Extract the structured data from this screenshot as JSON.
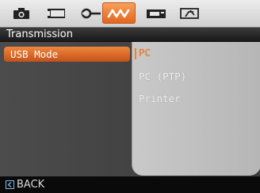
{
  "tabs": [
    {
      "icon": "camera-icon",
      "active": false
    },
    {
      "icon": "video-icon",
      "active": false
    },
    {
      "icon": "wrench-icon",
      "active": false
    },
    {
      "icon": "connection-icon",
      "active": true
    },
    {
      "icon": "print-icon",
      "active": false
    },
    {
      "icon": "edit-icon",
      "active": false
    }
  ],
  "section": {
    "title": "Transmission"
  },
  "menu": {
    "item_label": "USB Mode"
  },
  "options": [
    {
      "label": "PC",
      "selected": true
    },
    {
      "label": "PC (PTP)",
      "selected": false
    },
    {
      "label": "Printer",
      "selected": false
    }
  ],
  "footer": {
    "back_label": "BACK",
    "back_key_icon": "left-arrow-key-icon"
  },
  "colors": {
    "accent": "#e2621d",
    "selected_text": "#ff7a1a"
  }
}
